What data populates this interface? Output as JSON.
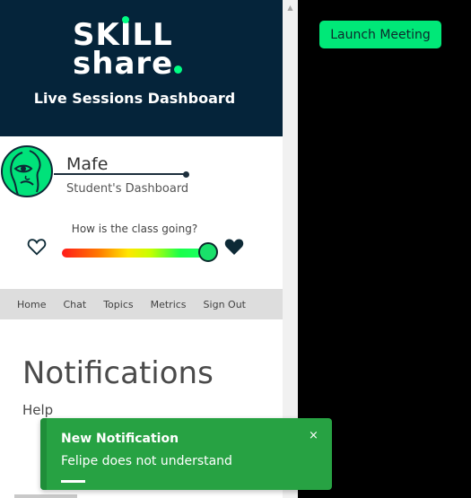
{
  "header": {
    "logo_line1": "SKILL",
    "logo_line2": "share",
    "title": "Live Sessions Dashboard"
  },
  "profile": {
    "name": "Mafe",
    "role": "Student's Dashboard"
  },
  "rating": {
    "question": "How is the class going?",
    "value": 1.0
  },
  "nav": {
    "items": [
      "Home",
      "Chat",
      "Topics",
      "Metrics",
      "Sign Out"
    ]
  },
  "notifications": {
    "title": "Notifications",
    "help": "Help"
  },
  "toast": {
    "title": "New Notification",
    "message": "Felipe does not understand",
    "close": "×"
  },
  "launch": {
    "label": "Launch Meeting"
  },
  "scrollbar": {
    "up_arrow": "▲"
  },
  "colors": {
    "header_bg": "#05243a",
    "accent_green": "#00e878",
    "toast_green": "#27a243",
    "nav_bg": "#dddddd"
  }
}
